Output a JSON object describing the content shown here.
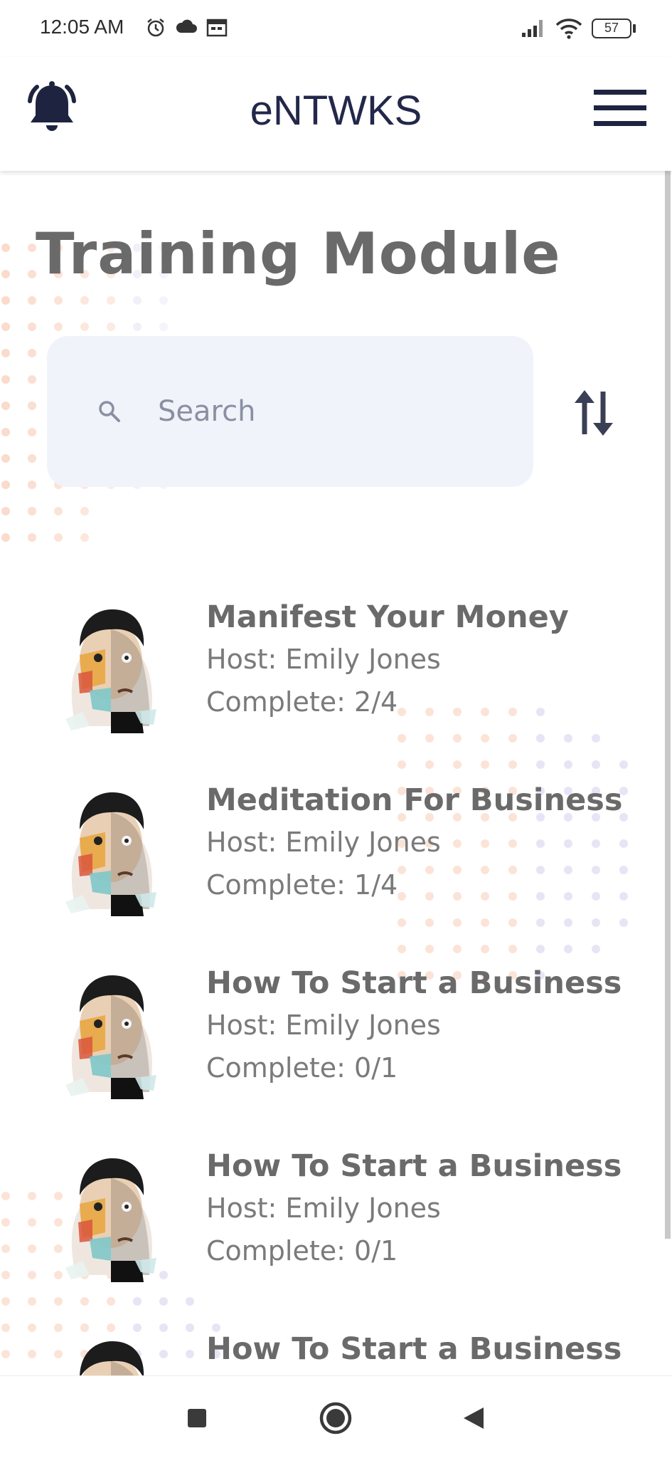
{
  "status_bar": {
    "time": "12:05 AM",
    "battery": "57",
    "icons": [
      "alarm-icon",
      "cloud-icon",
      "calendar-icon",
      "signal-icon",
      "wifi-icon",
      "battery-icon"
    ]
  },
  "app_bar": {
    "title": "eNTWKS",
    "left_icon": "bell-icon",
    "right_icon": "hamburger-menu-icon"
  },
  "page": {
    "title": "Training Module"
  },
  "search": {
    "placeholder": "Search",
    "icon": "search-icon"
  },
  "sort": {
    "icon": "sort-arrows-icon"
  },
  "modules": [
    {
      "title": "Manifest Your Money",
      "host": "Host: Emily Jones",
      "complete": "Complete: 2/4"
    },
    {
      "title": "Meditation For Business",
      "host": "Host: Emily Jones",
      "complete": "Complete: 1/4"
    },
    {
      "title": "How To Start a Business",
      "host": "Host: Emily Jones",
      "complete": "Complete: 0/1"
    },
    {
      "title": "How To Start a Business",
      "host": "Host: Emily Jones",
      "complete": "Complete: 0/1"
    },
    {
      "title": "How To Start a Business",
      "host": "",
      "complete": ""
    }
  ],
  "nav_bar": {
    "buttons": [
      "recents-square-icon",
      "home-circle-icon",
      "back-triangle-icon"
    ]
  },
  "colors": {
    "brand_navy": "#23284a",
    "title_gray": "#6a6a6a",
    "search_bg": "#f1f3fa",
    "dot_orange": "#f5b08e",
    "dot_purple": "#b7b4e6"
  }
}
